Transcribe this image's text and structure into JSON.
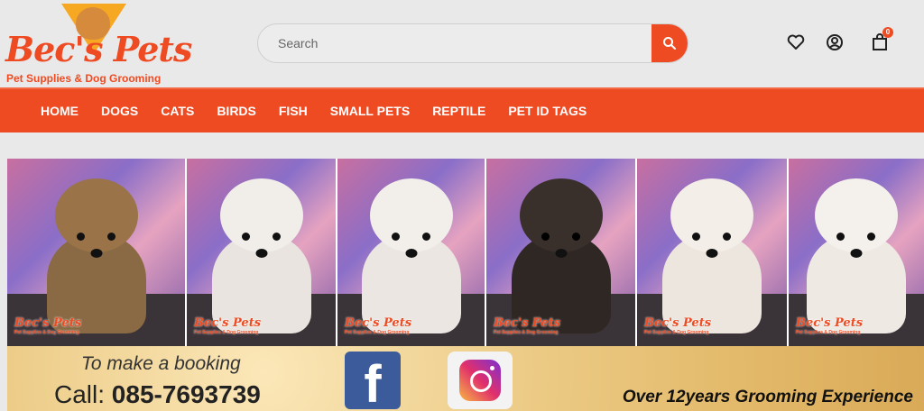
{
  "brand": {
    "name": "Bec's Pets",
    "tagline": "Pet Supplies & Dog Grooming"
  },
  "search": {
    "placeholder": "Search"
  },
  "header_icons": [
    "heart-icon",
    "user-icon",
    "cart-icon"
  ],
  "cart": {
    "count": "0"
  },
  "nav": {
    "items": [
      "HOME",
      "DOGS",
      "CATS",
      "BIRDS",
      "FISH",
      "SMALL PETS",
      "REPTILE",
      "PET ID TAGS"
    ]
  },
  "banner": {
    "booking_text": "To make a booking",
    "call_label": "Call:",
    "phone": "085-7693739",
    "facebook_letter": "f",
    "experience": "Over 12years Grooming Experience",
    "watermark_name": "Bec's Pets",
    "watermark_tag": "Pet Supplies & Dog Grooming"
  },
  "colors": {
    "accent": "#ee4b23",
    "header_bg": "#e9e9e9",
    "facebook": "#3b5b9a"
  }
}
